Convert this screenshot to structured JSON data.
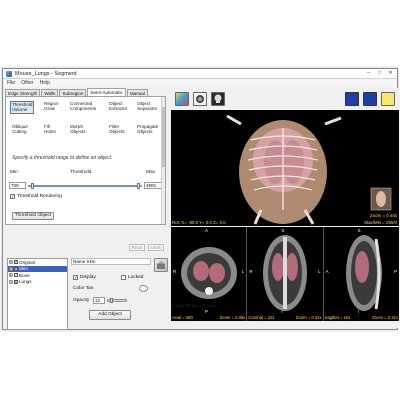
{
  "window": {
    "title": "Mouse_Lungs - Segment",
    "buttons": {
      "minimize": "–",
      "maximize": "□",
      "close": "✕"
    }
  },
  "menu": [
    "File",
    "Other",
    "Help"
  ],
  "tabs": [
    "Edge Strength",
    "Walls",
    "Subregion",
    "Semi-Automatic",
    "Manual"
  ],
  "active_tab": "Semi-Automatic",
  "tools": [
    {
      "label1": "Threshold",
      "label2": "Volume",
      "active": true
    },
    {
      "label1": "Region",
      "label2": "Grow",
      "active": false
    },
    {
      "label1": "Connected",
      "label2": "Components",
      "active": false
    },
    {
      "label1": "Object",
      "label2": "Extractor",
      "active": false
    },
    {
      "label1": "Object",
      "label2": "Separator",
      "active": false
    },
    {
      "label1": "Oblique",
      "label2": "Cutting",
      "active": false
    },
    {
      "label1": "Fill",
      "label2": "Holes",
      "active": false
    },
    {
      "label1": "Morph",
      "label2": "Objects",
      "active": false
    },
    {
      "label1": "Filter",
      "label2": "Objects",
      "active": false
    },
    {
      "label1": "Propagate",
      "label2": "Objects",
      "active": false
    }
  ],
  "hint": "Specify a threshold range to define an object.",
  "threshold": {
    "min_label": "Min",
    "center_label": "Threshold",
    "max_label": "Max",
    "min_value": "708",
    "max_value": "4981",
    "low_fraction": 0.03,
    "high_fraction": 0.98,
    "rendering_label": "Threshold Rendering",
    "rendering_checked": true,
    "rendering_mark": "✓",
    "button": "Threshold Object"
  },
  "history": {
    "redo": "Redo",
    "undo": "Undo"
  },
  "objects": [
    {
      "name": "Original",
      "color": "#c8c8c8",
      "selected": false
    },
    {
      "name": "Skin",
      "color": "#d2b48c",
      "selected": true
    },
    {
      "name": "Bone",
      "color": "#f2f2f2",
      "selected": false
    },
    {
      "name": "Lungs",
      "color": "#e0a0b0",
      "selected": false
    }
  ],
  "properties": {
    "name_label": "Name",
    "name_value": "Skin",
    "display_label": "Display",
    "display_mark": "✓",
    "locked_label": "Locked",
    "color_label": "Color",
    "color_value": "Tan",
    "opacity_label": "Opacity",
    "opacity_value": "13",
    "add_button": "Add Object"
  },
  "viewer": {
    "status_3d": "Rot: X= -90.0  Y= 0.0  Z= 0.0",
    "zoom_3d": "Zoom = 0.40x",
    "maxmin_3d": "Max/Min = 255/0",
    "slices": [
      {
        "caption_left": "Axial = 260",
        "caption_right": "Zoom = 0.38x",
        "top": "A",
        "left": "R",
        "right": "L",
        "bottom": "P"
      },
      {
        "caption_left": "Coronal = 221",
        "caption_right": "Zoom = 0.31x",
        "top": "S",
        "left": "R",
        "right": "L",
        "bottom": "I"
      },
      {
        "caption_left": "Sagittal = 151",
        "caption_right": "Zoom = 0.31x",
        "top": "S",
        "left": "A",
        "right": "P",
        "bottom": "I"
      }
    ],
    "status_bar": "Display Mode = Traces"
  },
  "icons": [
    "views-icon",
    "render-icon",
    "skull-icon",
    "monitor-single-icon",
    "monitor-dual-icon",
    "notes-icon"
  ],
  "colors": {
    "selection": "#3b5fc4",
    "overlay_text": "#ffd84d"
  }
}
